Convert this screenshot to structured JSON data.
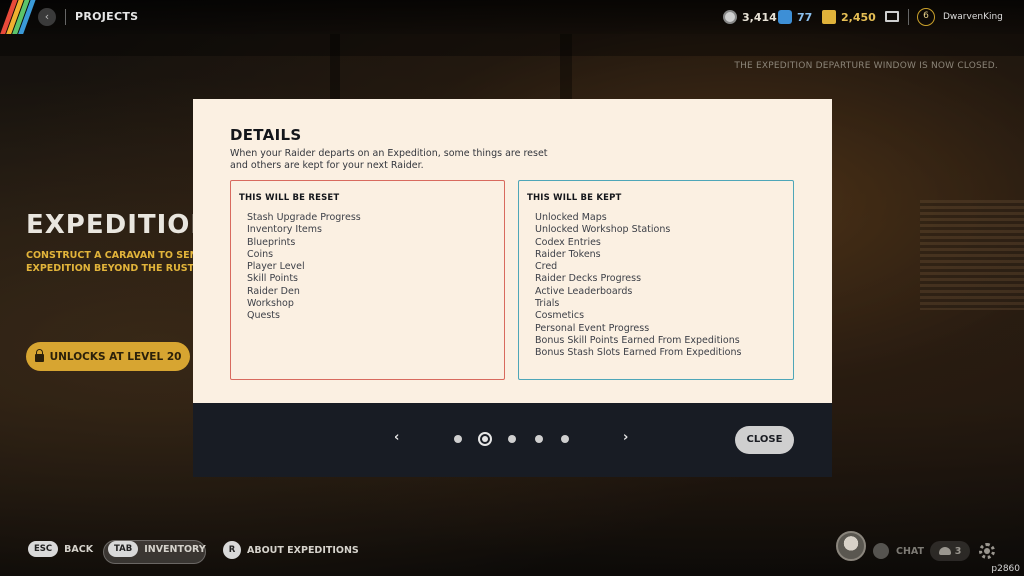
{
  "topbar": {
    "title": "PROJECTS",
    "back_icon": "back-arrow-icon",
    "currencies": [
      {
        "icon": "silver-coin-icon",
        "value": "3,414",
        "color": "#d0d0d0"
      },
      {
        "icon": "blue-token-icon",
        "value": "77",
        "color": "#3d8fd6"
      },
      {
        "icon": "gold-stack-icon",
        "value": "2,450",
        "color": "#e0b23a"
      }
    ],
    "level": "6",
    "username": "DwarvenKing"
  },
  "notice": "THE EXPEDITION DEPARTURE WINDOW IS NOW CLOSED.",
  "left_panel": {
    "title": "EXPEDITION",
    "description_lines": [
      "CONSTRUCT A CARAVAN TO SEN",
      "EXPEDITION BEYOND THE RUST B"
    ],
    "unlock_label": "UNLOCKS AT LEVEL 20"
  },
  "modal": {
    "title": "DETAILS",
    "text": "When your Raider departs on an Expedition, some things are reset and others are kept for your next Raider.",
    "reset": {
      "heading": "THIS WILL BE RESET",
      "items": [
        "Stash Upgrade Progress",
        "Inventory Items",
        "Blueprints",
        "Coins",
        "Player Level",
        "Skill Points",
        "Raider Den",
        "Workshop",
        "Quests"
      ]
    },
    "kept": {
      "heading": "THIS WILL BE KEPT",
      "items": [
        "Unlocked Maps",
        "Unlocked Workshop Stations",
        "Codex Entries",
        "Raider Tokens",
        "Cred",
        "Raider Decks Progress",
        "Active Leaderboards",
        "Trials",
        "Cosmetics",
        "Personal Event Progress",
        "Bonus Skill Points Earned From Expeditions",
        "Bonus Stash Slots Earned From Expeditions"
      ]
    },
    "pager": {
      "prev": "‹",
      "next": "›",
      "pages": 5,
      "current": 2
    },
    "close_label": "CLOSE",
    "colors": {
      "reset_border": "#d86a5e",
      "kept_border": "#4ea6b8",
      "body_bg": "#fbf0e2",
      "footer_bg": "#181c24"
    }
  },
  "bottombar": {
    "back": {
      "key": "ESC",
      "label": "BACK"
    },
    "inventory": {
      "key": "TAB",
      "label": "INVENTORY"
    },
    "about": {
      "key": "R",
      "label": "ABOUT EXPEDITIONS"
    },
    "chat_label": "CHAT",
    "party_count": "3",
    "build_id": "p2860"
  }
}
